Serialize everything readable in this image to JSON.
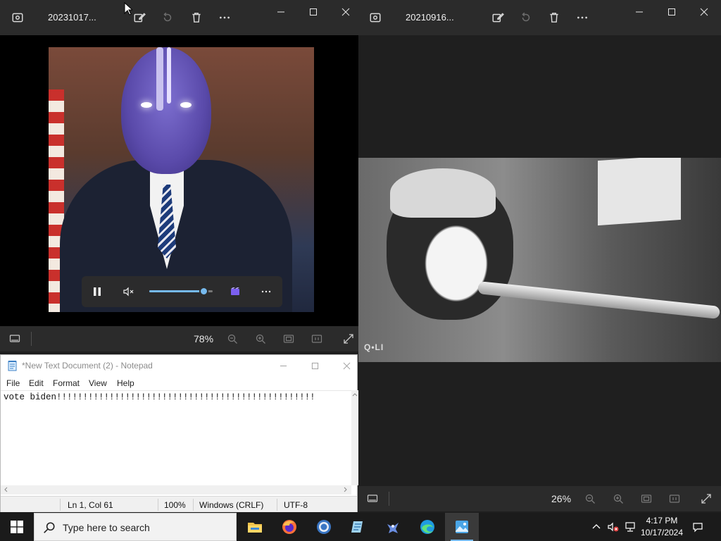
{
  "window_left": {
    "title": "20231017...",
    "zoom": "78%",
    "media_controls": {
      "volume_level": 0.85
    }
  },
  "window_right": {
    "title": "20210916...",
    "zoom": "26%",
    "watermark": "Q•LI"
  },
  "notepad": {
    "title": "*New Text Document (2) - Notepad",
    "menu": [
      "File",
      "Edit",
      "Format",
      "View",
      "Help"
    ],
    "content": "vote biden!!!!!!!!!!!!!!!!!!!!!!!!!!!!!!!!!!!!!!!!!!!!!!!!!",
    "status": {
      "position": "Ln 1, Col 61",
      "zoom": "100%",
      "line_ending": "Windows (CRLF)",
      "encoding": "UTF-8"
    }
  },
  "taskbar": {
    "search_placeholder": "Type here to search",
    "time": "4:17 PM",
    "date": "10/17/2024",
    "accent": "#76b9ed"
  }
}
